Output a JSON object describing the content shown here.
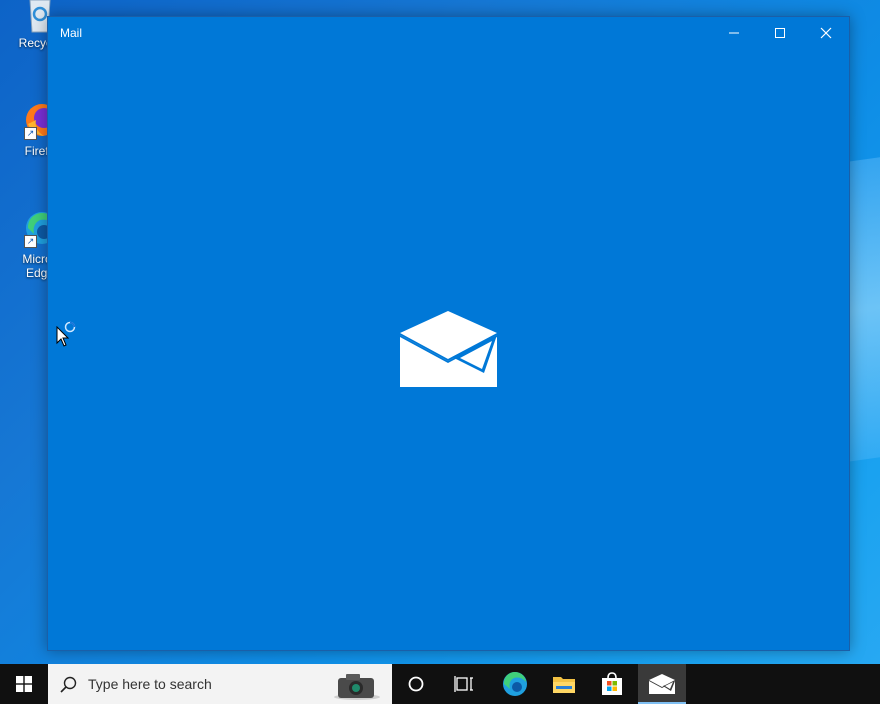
{
  "desktop": {
    "icons": [
      {
        "label": "Recycle",
        "icon": "recycle-bin-icon"
      },
      {
        "label": "Firefo",
        "icon": "firefox-icon"
      },
      {
        "label": "Micros",
        "label2": "Edge",
        "icon": "edge-icon"
      }
    ]
  },
  "window": {
    "title": "Mail",
    "accent": "#0078d7",
    "minimize_icon": "minimize-icon",
    "maximize_icon": "maximize-icon",
    "close_icon": "close-icon",
    "splash_icon": "mail-envelope-icon"
  },
  "taskbar": {
    "start_icon": "windows-logo-icon",
    "search": {
      "placeholder": "Type here to search",
      "icon": "search-icon"
    },
    "items": [
      {
        "name": "cortana",
        "icon": "cortana-circle-icon"
      },
      {
        "name": "task-view",
        "icon": "task-view-icon"
      },
      {
        "name": "edge",
        "icon": "edge-icon"
      },
      {
        "name": "file-explorer",
        "icon": "folder-icon"
      },
      {
        "name": "store",
        "icon": "store-bag-icon"
      },
      {
        "name": "mail",
        "icon": "mail-icon",
        "active": true
      }
    ],
    "background": "#101010"
  }
}
